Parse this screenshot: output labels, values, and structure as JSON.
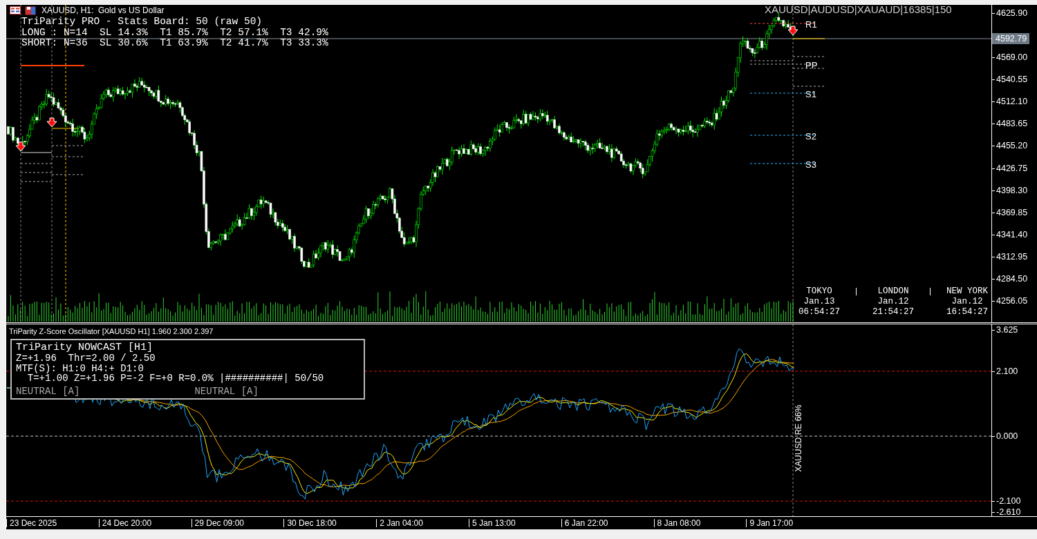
{
  "window": {
    "title": "XAUUSD, H1:  Gold vs US Dollar"
  },
  "stats_board": {
    "title": "TriParity PRO - Stats Board: 50 (raw 50)",
    "rows": [
      "LONG : N=14  SL 14.3%  T1 85.7%  T2 57.1%  T3 42.9%",
      "SHORT: N=36  SL 30.6%  T1 63.9%  T2 41.7%  T3 33.3%"
    ]
  },
  "symbol_set": "XAUUSD|AUDUSD|XAUAUD|16385|150",
  "pivot_levels": [
    {
      "label": "R1",
      "kind": "resistance"
    },
    {
      "label": "PP",
      "kind": "pivot"
    },
    {
      "label": "S1",
      "kind": "support"
    },
    {
      "label": "S2",
      "kind": "support"
    },
    {
      "label": "S3",
      "kind": "support"
    }
  ],
  "price_axis": {
    "ticks": [
      "4625.90",
      "4569.00",
      "4540.55",
      "4512.10",
      "4483.65",
      "4455.20",
      "4426.75",
      "4398.30",
      "4369.85",
      "4341.40",
      "4312.95",
      "4284.50",
      "4256.05"
    ],
    "current_price": "4592.79"
  },
  "sessions": [
    {
      "city": "TOKYO",
      "date": "Jan.13",
      "time": "06:54:27"
    },
    {
      "city": "LONDON",
      "date": "Jan.12",
      "time": "21:54:27"
    },
    {
      "city": "NEW YORK",
      "date": "Jan.12",
      "time": "16:54:27"
    }
  ],
  "oscillator": {
    "title": "TriParity Z-Score Oscillator [XAUUSD H1] 1.960 2.300 2.397",
    "vertical_label": "XAUUSD RE 66%",
    "axis_ticks": [
      "3.625",
      "2.100",
      "0.000",
      "-2.100",
      "-2.610"
    ],
    "nowcast": {
      "title": "TriParity NOWCAST [H1]",
      "lines": [
        "Z=+1.96  Thr=2.00 / 2.50",
        "MTF(S): H1:0 H4:+ D1:0",
        "  T=+1.00 Z=+1.96 P=-2 F=+0 R=0.0% |##########| 50/50"
      ],
      "states": [
        "NEUTRAL [A]",
        "NEUTRAL [A]"
      ]
    }
  },
  "time_axis": [
    "23 Dec 2025",
    "24 Dec 20:00",
    "29 Dec 09:00",
    "30 Dec 18:00",
    "2 Jan 04:00",
    "5 Jan 13:00",
    "6 Jan 22:00",
    "8 Jan 08:00",
    "9 Jan 17:00"
  ]
}
